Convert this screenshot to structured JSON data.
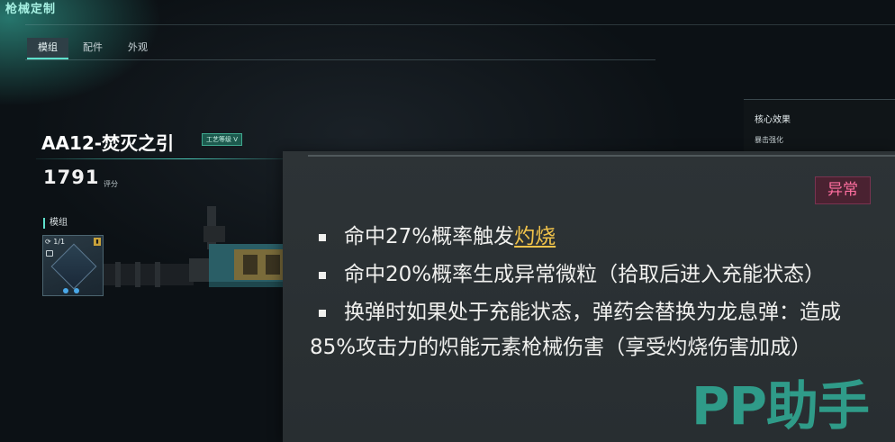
{
  "header": {
    "title": "枪械定制"
  },
  "tabs": [
    {
      "label": "模组",
      "active": true
    },
    {
      "label": "配件",
      "active": false
    },
    {
      "label": "外观",
      "active": false
    }
  ],
  "weapon": {
    "name": "AA12-焚灭之引",
    "tier_badge": "工艺等级 V",
    "score": "1791",
    "score_label": "评分"
  },
  "mods": {
    "section_label": "模组",
    "slot": {
      "count": "1/1",
      "icon": "mod-crystal-icon",
      "dots": 2
    }
  },
  "core_effect": {
    "title": "核心效果",
    "item": "暴击强化"
  },
  "effect_popup": {
    "tag": "异常",
    "tag_color": "#ff6fa0",
    "effects": [
      {
        "prefix": "命中27%概率触发",
        "keyword": "灼烧",
        "suffix": ""
      },
      {
        "text": "命中20%概率生成异常微粒（拾取后进入充能状态）"
      },
      {
        "text": "换弹时如果处于充能状态，弹药会替换为龙息弹：造成85%攻击力的炽能元素枪械伤害（享受灼烧伤害加成）"
      }
    ]
  },
  "watermark": "PP助手",
  "colors": {
    "accent": "#5ee0cc",
    "keyword": "#f0c24a",
    "watermark": "#34debe"
  }
}
